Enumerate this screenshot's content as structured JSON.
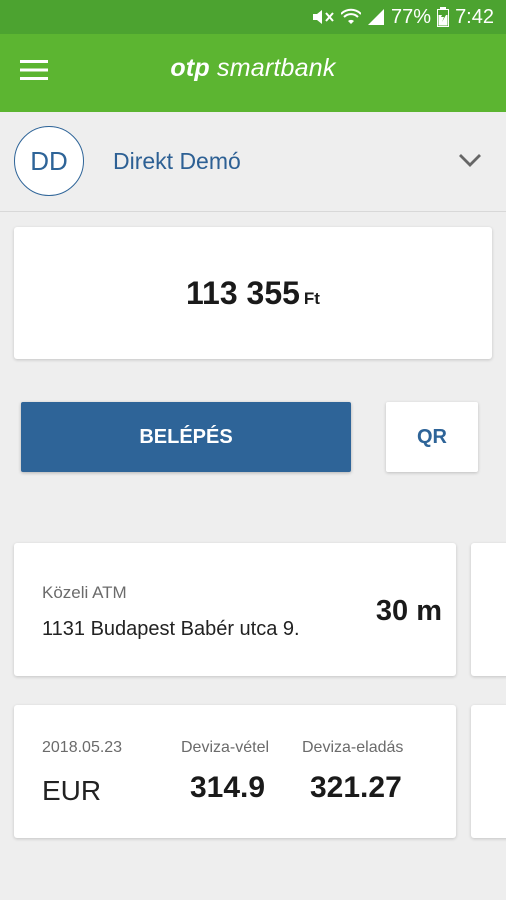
{
  "status_bar": {
    "battery": "77%",
    "time": "7:42",
    "icons": [
      "mute-icon",
      "wifi-icon",
      "signal-icon",
      "battery-icon"
    ]
  },
  "app_bar": {
    "logo_bold": "otp",
    "logo_rest": "smartbank",
    "menu_icon": "hamburger-menu-icon"
  },
  "profile": {
    "initials": "DD",
    "name": "Direkt Demó",
    "chevron_icon": "chevron-down-icon"
  },
  "balance": {
    "amount": "113 355",
    "currency": "Ft"
  },
  "actions": {
    "login_label": "BELÉPÉS",
    "qr_label": "QR"
  },
  "atm": {
    "label": "Közeli ATM",
    "address": "1131 Budapest Babér utca 9.",
    "distance": "30 m"
  },
  "exchange": {
    "date": "2018.05.23",
    "currency": "EUR",
    "buy_label": "Deviza-vétel",
    "sell_label": "Deviza-eladás",
    "buy_rate": "314.9",
    "sell_rate": "321.27"
  },
  "colors": {
    "status_green": "#4ca330",
    "appbar_green": "#5cb531",
    "brand_blue": "#2e6498"
  }
}
